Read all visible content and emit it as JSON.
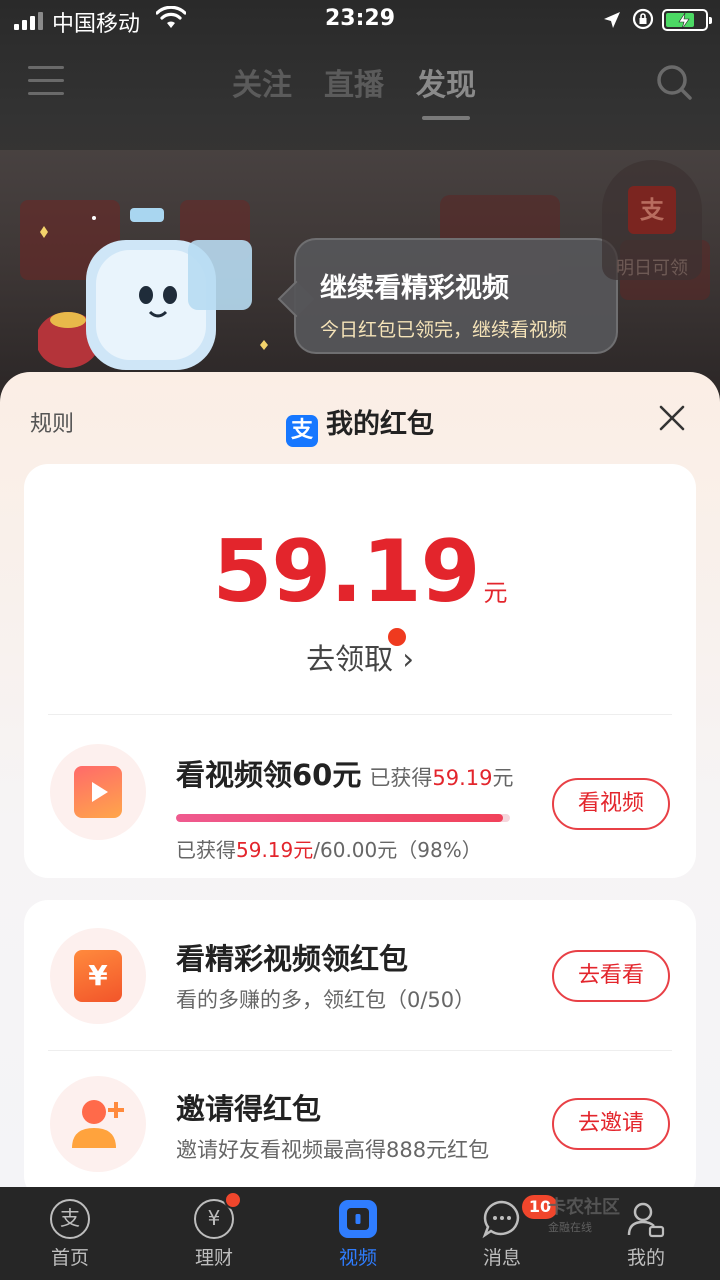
{
  "status_bar": {
    "carrier": "中国移动",
    "time": "23:29"
  },
  "top_nav": {
    "tabs": [
      {
        "label": "关注"
      },
      {
        "label": "直播"
      },
      {
        "label": "发现"
      }
    ],
    "active_tab": "发现"
  },
  "bubble": {
    "title": "继续看精彩视频",
    "subtitle": "今日红包已领完，继续看视频"
  },
  "float_redpack": {
    "icon_char": "支",
    "label": "明日可领"
  },
  "sheet": {
    "rules_label": "规则",
    "logo_char": "支",
    "title": "我的红包",
    "amount": "59.19",
    "amount_unit": "元",
    "claim_label": "去领取",
    "claim_arrow": "›"
  },
  "task_watch": {
    "title": "看视频领60元",
    "gain_prefix": "已获得",
    "gain_value": "59.19",
    "gain_unit": "元",
    "progress_prefix": "已获得",
    "progress_value": "59.19元",
    "progress_rest": "/60.00元（98%）",
    "progress_fraction": 0.98,
    "button": "看视频"
  },
  "task_redpack": {
    "icon_char": "¥",
    "title": "看精彩视频领红包",
    "subtitle": "看的多赚的多，领红包（0/50）",
    "button": "去看看"
  },
  "task_invite": {
    "title": "邀请得红包",
    "subtitle": "邀请好友看视频最高得888元红包",
    "button": "去邀请"
  },
  "tabbar": {
    "items": [
      {
        "label": "首页",
        "icon": "alipay-home-icon"
      },
      {
        "label": "理财",
        "icon": "wealth-icon"
      },
      {
        "label": "视频",
        "icon": "video-icon"
      },
      {
        "label": "消息",
        "icon": "message-icon"
      },
      {
        "label": "我的",
        "icon": "profile-icon"
      }
    ],
    "active": "视频",
    "message_badge": "10",
    "home_icon_char": "支",
    "wealth_icon_char": "¥"
  },
  "watermark": {
    "text": "卡农社区",
    "sub": "金融在线"
  },
  "colors": {
    "accent_red": "#e3252c",
    "alipay_blue": "#1677ff",
    "tab_active": "#2f7dff"
  }
}
